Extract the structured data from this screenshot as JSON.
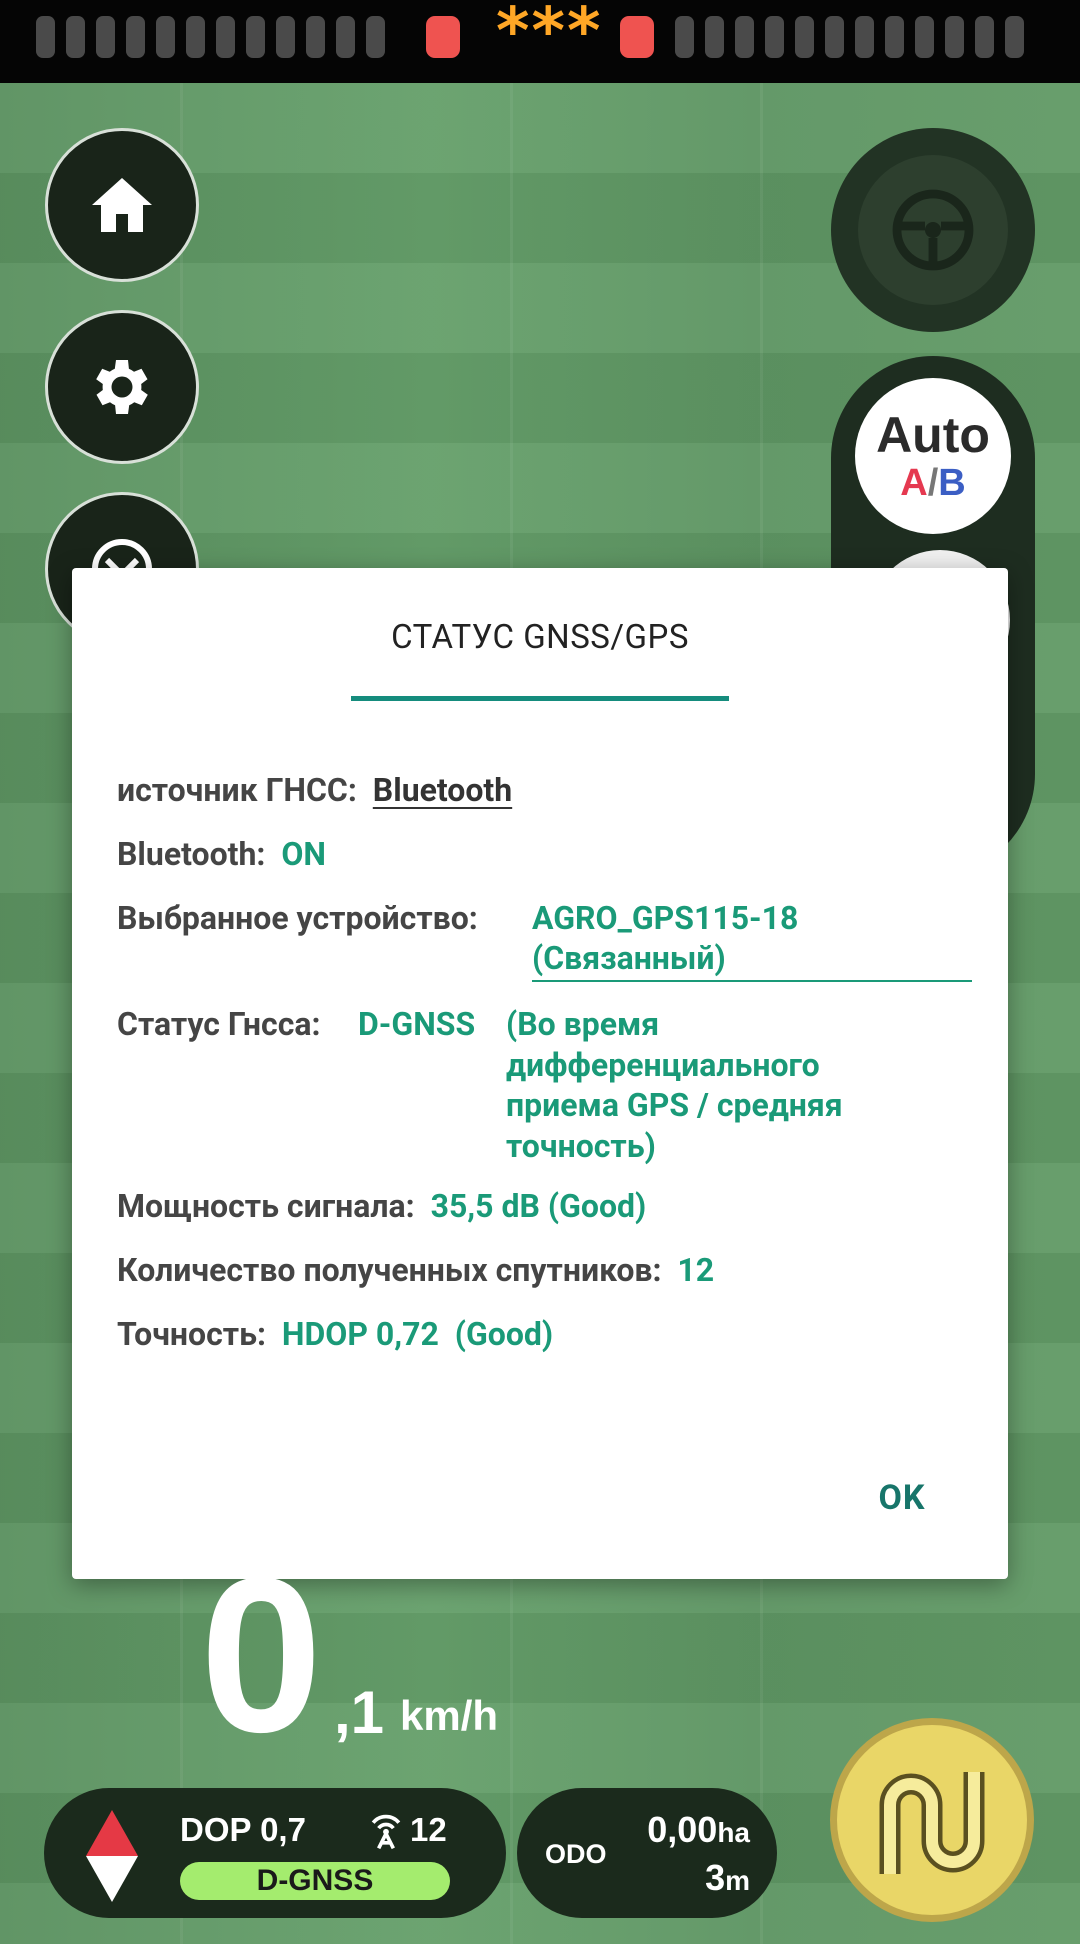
{
  "status_bar": {
    "indicator": "***",
    "colors": {
      "segment": "#4a4a4a",
      "alert": "#ef5350",
      "stars": "#ffa726"
    }
  },
  "left_controls": {
    "icons": [
      "home-icon",
      "gear-icon",
      "compass-icon"
    ]
  },
  "right_controls": {
    "auto_ab": {
      "word": "Auto",
      "a": "A",
      "slash": "/",
      "b": "B"
    }
  },
  "dialog": {
    "title": "СТАТУС GNSS/GPS",
    "source": {
      "label": "источник ГНСС:",
      "value": "Bluetooth"
    },
    "bluetooth": {
      "label": "Bluetooth:",
      "value": "ON"
    },
    "device": {
      "label": "Выбранное устройство:",
      "line1": "AGRO_GPS115-18",
      "line2": "(Связанный)"
    },
    "gnss_status": {
      "label": "Статус Гнсса:",
      "value": "D-GNSS",
      "detail_lines": [
        "(Во время",
        "дифференциального",
        "приема GPS / средняя",
        "точность)"
      ]
    },
    "signal": {
      "label": "Мощность сигнала:",
      "value": "35,5 dB (Good)"
    },
    "satellites": {
      "label": "Количество полученных спутников:",
      "value": "12"
    },
    "accuracy": {
      "label": "Точность:",
      "value": "HDOP 0,72  (Good)"
    },
    "ok_label": "OK",
    "accent_color": "#1a9a78"
  },
  "speed": {
    "integer": "0",
    "fraction": ",1",
    "unit": "km/h"
  },
  "gnss_panel": {
    "dop": "DOP 0,7",
    "satellites": "12",
    "status": "D-GNSS",
    "badge_color": "#a4ec6e"
  },
  "odo_panel": {
    "label": "ODO",
    "area_value": "0,00",
    "area_unit": "ha",
    "distance_value": "3",
    "distance_unit": "m"
  }
}
